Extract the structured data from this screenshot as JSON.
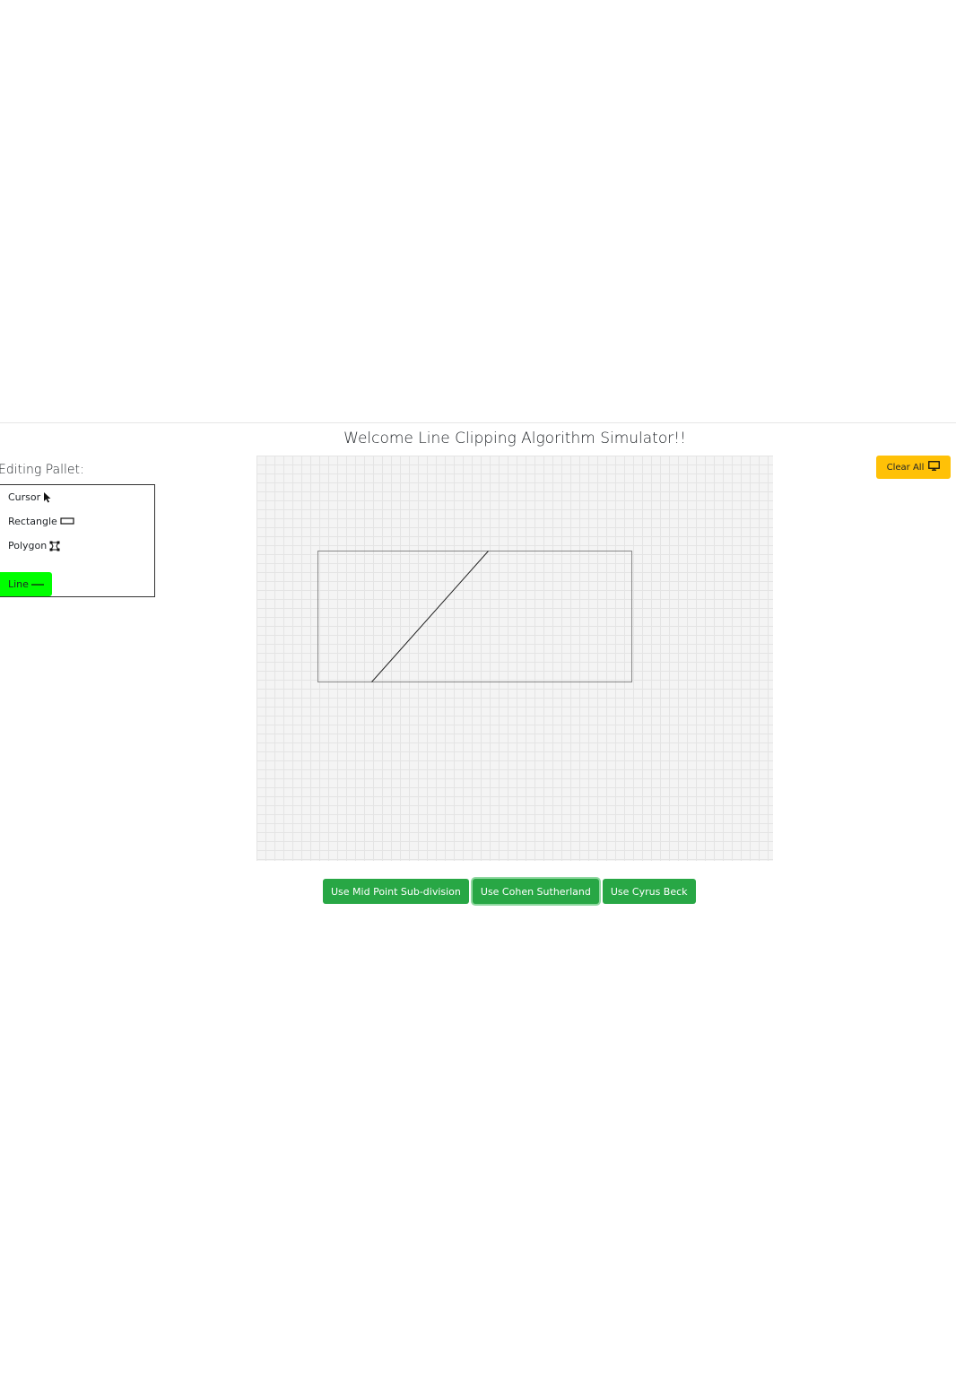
{
  "page": {
    "title": "Welcome Line Clipping Algorithm Simulator!!"
  },
  "pallet": {
    "heading": "Editing Pallet:",
    "tools": [
      {
        "label": "Cursor",
        "icon": "cursor-arrow-icon"
      },
      {
        "label": "Rectangle",
        "icon": "rectangle-icon"
      },
      {
        "label": "Polygon",
        "icon": "polygon-icon"
      },
      {
        "label": "Line",
        "icon": "line-icon",
        "active": true
      }
    ],
    "active_color": "#00ff00"
  },
  "toolbar": {
    "clear_label": "Clear All",
    "clear_icon": "monitor-icon",
    "clear_color": "#ffc107"
  },
  "algorithms": {
    "color": "#28a745",
    "buttons": [
      {
        "label": "Use Mid Point Sub-division"
      },
      {
        "label": "Use Cohen Sutherland",
        "focused": true
      },
      {
        "label": "Use Cyrus Beck"
      }
    ]
  }
}
